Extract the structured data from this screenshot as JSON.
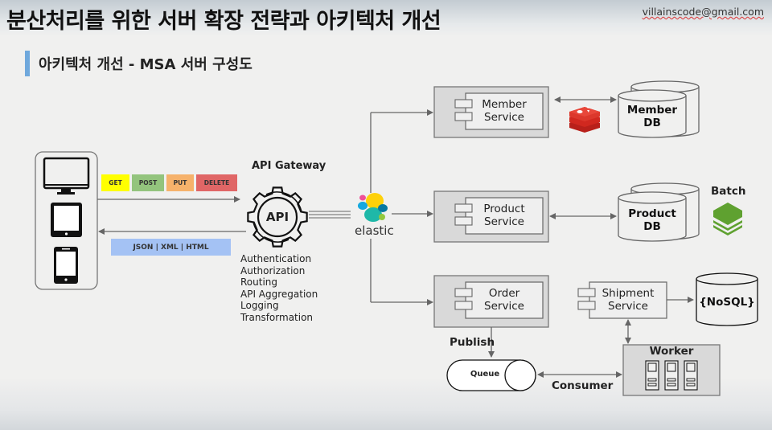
{
  "header": {
    "title": "분산처리를 위한 서버 확장 전략과 아키텍처 개선",
    "email": "villainscode@gmail.com"
  },
  "section": {
    "subtitle": "아키텍처 개선 - MSA 서버 구성도",
    "accent_color": "#6fa8dc"
  },
  "clients": {
    "icons": [
      "desktop-monitor-icon",
      "tablet-icon",
      "smartphone-icon"
    ]
  },
  "request_methods": [
    {
      "label": "GET",
      "color": "#ffff00"
    },
    {
      "label": "POST",
      "color": "#93c47d"
    },
    {
      "label": "PUT",
      "color": "#f6b26b"
    },
    {
      "label": "DELETE",
      "color": "#e06666"
    }
  ],
  "response_formats": {
    "label": "JSON | XML | HTML",
    "color": "#a4c2f4"
  },
  "api_gateway": {
    "title": "API Gateway",
    "icon_text": "API",
    "features": [
      "Authentication",
      "Authorization",
      "Routing",
      "API Aggregation",
      "Logging",
      "Transformation"
    ]
  },
  "load_balancer": {
    "label": "elastic"
  },
  "services": {
    "member": {
      "line1": "Member",
      "line2": "Service"
    },
    "product": {
      "line1": "Product",
      "line2": "Service"
    },
    "order": {
      "line1": "Order",
      "line2": "Service"
    },
    "shipment": {
      "line1": "Shipment",
      "line2": "Service"
    }
  },
  "databases": {
    "member": {
      "line1": "Member",
      "line2": "DB"
    },
    "product": {
      "line1": "Product",
      "line2": "DB"
    },
    "nosql": {
      "label": "{NoSQL}"
    }
  },
  "batch": {
    "label": "Batch"
  },
  "messaging": {
    "publish_label": "Publish",
    "queue_label": "Queue",
    "consumer_label": "Consumer",
    "worker_label": "Worker"
  }
}
